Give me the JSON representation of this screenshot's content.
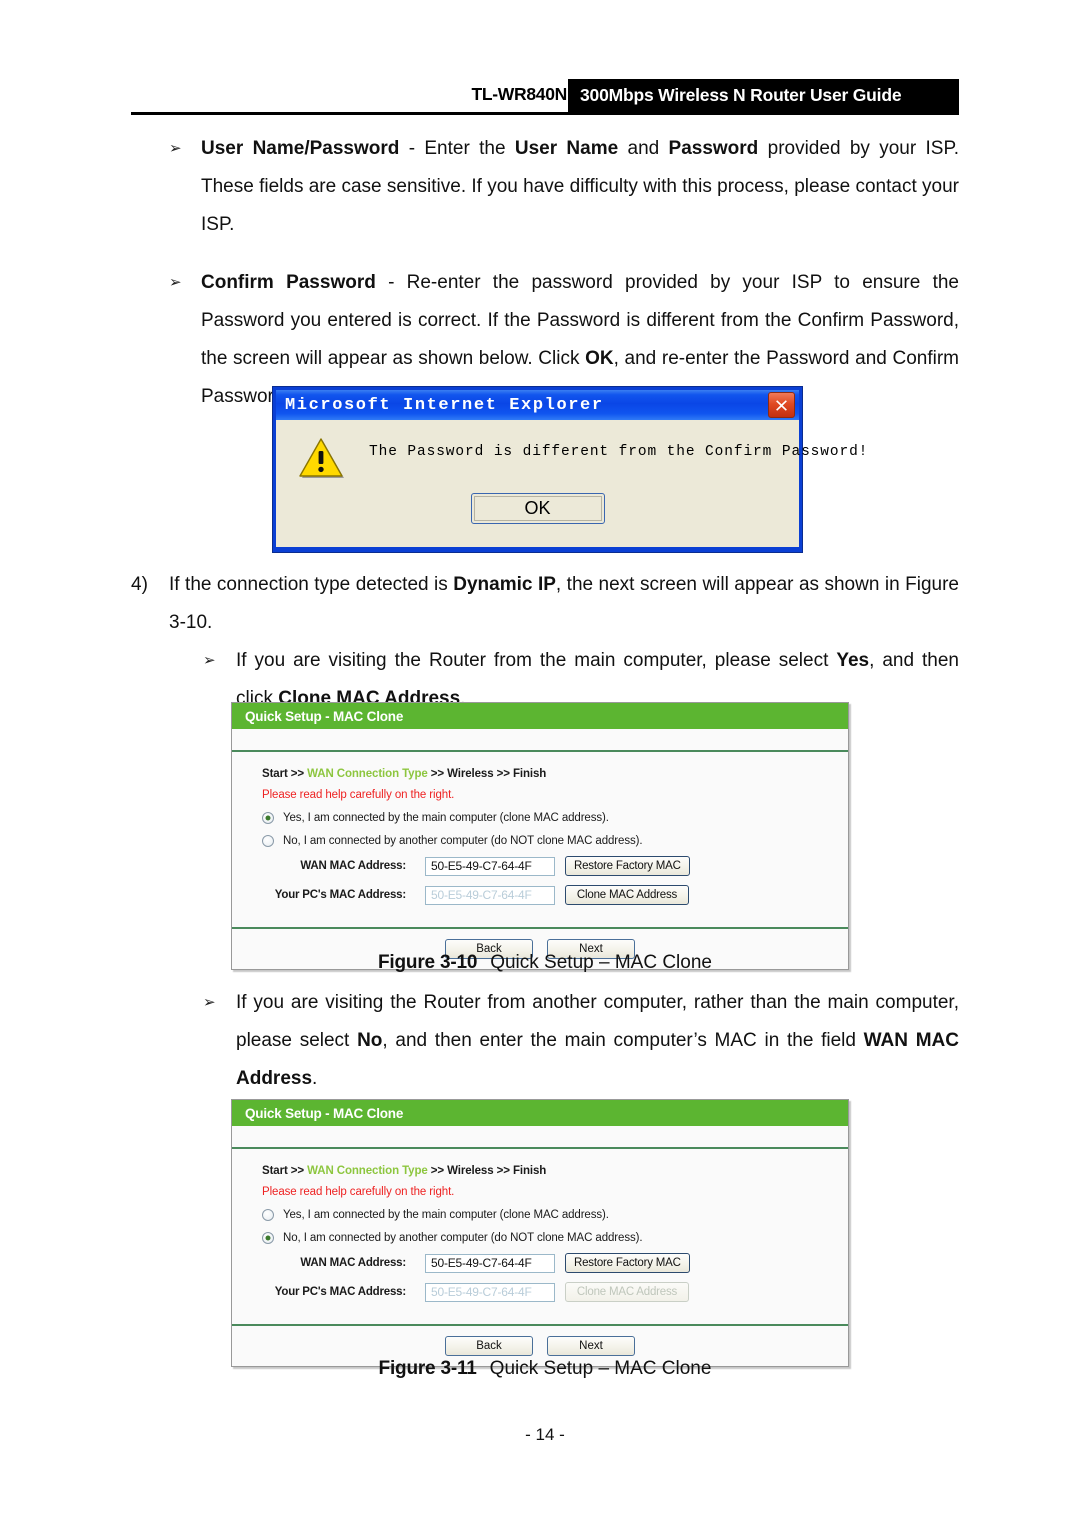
{
  "header": {
    "model": "TL-WR840N",
    "banner": "300Mbps Wireless N Router User Guide"
  },
  "body_text": {
    "bullet1_marker": "➢",
    "bullet1_bold_lead": "User Name/Password",
    "bullet1_dash": " - ",
    "bullet1_t1": "Enter the ",
    "bullet1_b1": "User Name",
    "bullet1_t2": " and ",
    "bullet1_b2": "Password",
    "bullet1_t3": " provided by your ISP. These fields are case sensitive. If you have difficulty with this process, please contact your ISP.",
    "bullet2_marker": "➢",
    "bullet2_bold_lead": "Confirm Password",
    "bullet2_dash": " - ",
    "bullet2_t1": "Re-enter the password provided by your ISP to ensure the Password you entered is correct. If the Password is different from the Confirm Password, the screen will appear as shown below. Click ",
    "bullet2_b1": "OK",
    "bullet2_t2": ", and re-enter the Password and Confirm Password.",
    "item4_marker": "4)",
    "item4_t1": "If the connection type detected is ",
    "item4_b1": "Dynamic IP",
    "item4_t2": ", the next screen will appear as shown in Figure 3-10.",
    "bullet3_marker": "➢",
    "bullet3_t1": "If you are visiting the Router from the main computer, please select ",
    "bullet3_b1": "Yes",
    "bullet3_t2": ", and then click ",
    "bullet3_b2": "Clone MAC Address",
    "bullet3_t3": ".",
    "bullet4_marker": "➢",
    "bullet4_t1": "If you are visiting the Router from another computer, rather than the main computer, please select ",
    "bullet4_b1": "No",
    "bullet4_t2": ", and then enter the main computer’s MAC in the field ",
    "bullet4_b2": "WAN MAC Address",
    "bullet4_t3": "."
  },
  "ie_dialog": {
    "title": "Microsoft Internet Explorer",
    "message": "The Password is different from the Confirm Password!",
    "ok_label": "OK",
    "close_icon": "close-icon",
    "warning_icon": "warning-triangle-icon",
    "titlebar_color": "#0a46e6",
    "body_color": "#ece9d8",
    "close_color": "#c22f10",
    "warning_color": "#ffd900"
  },
  "figure_3_10": {
    "panel": {
      "title": "Quick Setup - MAC Clone",
      "breadcrumb": {
        "start": "Start",
        "sep1": " >> ",
        "wan": "WAN Connection Type",
        "sep2": " >> ",
        "wireless": "Wireless",
        "sep3": " >> ",
        "finish": "Finish"
      },
      "note": "Please read help carefully on the right.",
      "radios": [
        {
          "label": "Yes, I am connected by the main computer (clone MAC address).",
          "checked": true
        },
        {
          "label": "No, I am connected by another computer (do NOT clone MAC address).",
          "checked": false
        }
      ],
      "fields": [
        {
          "label": "WAN MAC Address:",
          "value": "50-E5-49-C7-64-4F",
          "disabled": false,
          "button": "Restore Factory MAC",
          "button_disabled": false
        },
        {
          "label": "Your PC's MAC Address:",
          "value": "50-E5-49-C7-64-4F",
          "disabled": true,
          "button": "Clone MAC Address",
          "button_disabled": false
        }
      ],
      "back_label": "Back",
      "next_label": "Next",
      "header_color": "#5cb531",
      "note_color": "#ee2222",
      "crumb_active_color": "#8dc63f"
    },
    "caption_num": "Figure 3-10",
    "caption_text": "Quick Setup – MAC Clone"
  },
  "figure_3_11": {
    "panel": {
      "title": "Quick Setup - MAC Clone",
      "breadcrumb": {
        "start": "Start",
        "sep1": " >> ",
        "wan": "WAN Connection Type",
        "sep2": " >> ",
        "wireless": "Wireless",
        "sep3": " >> ",
        "finish": "Finish"
      },
      "note": "Please read help carefully on the right.",
      "radios": [
        {
          "label": "Yes, I am connected by the main computer (clone MAC address).",
          "checked": false
        },
        {
          "label": "No, I am connected by another computer (do NOT clone MAC address).",
          "checked": true
        }
      ],
      "fields": [
        {
          "label": "WAN MAC Address:",
          "value": "50-E5-49-C7-64-4F",
          "disabled": false,
          "button": "Restore Factory MAC",
          "button_disabled": false
        },
        {
          "label": "Your PC's MAC Address:",
          "value": "50-E5-49-C7-64-4F",
          "disabled": true,
          "button": "Clone MAC Address",
          "button_disabled": true
        }
      ],
      "back_label": "Back",
      "next_label": "Next"
    },
    "caption_num": "Figure 3-11",
    "caption_text": "Quick Setup – MAC Clone"
  },
  "footer": {
    "page_number": "- 14 -"
  }
}
